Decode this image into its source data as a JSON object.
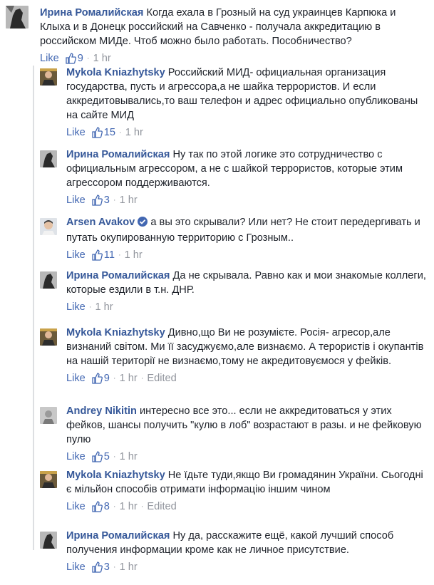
{
  "top": {
    "author": "Ирина Ромалийская",
    "text": "Когда ехала в Грозный на суд украинцев Карпюка и Клыха и в Донецк российский на Савченко - получала аккредитацию в российском МИДе. Чтоб можно было работать. Пособничество?",
    "like_label": "Like",
    "reactions": "9",
    "time": "1 hr"
  },
  "replies": [
    {
      "author": "Mykola Kniazhytsky",
      "text": "Российский МИД- официальная организация государства, пусть и агрессора,а не шайка террористов. И если аккредитовывались,то ваш телефон и адрес официально опубликованы на сайте МИД",
      "like_label": "Like",
      "reactions": "15",
      "time": "1 hr",
      "edited": ""
    },
    {
      "author": "Ирина Ромалийская",
      "text": "Ну так по этой логике это сотрудничество с официальным агрессором, а не с шайкой террористов, которые этим агрессором поддерживаются.",
      "like_label": "Like",
      "reactions": "3",
      "time": "1 hr",
      "edited": ""
    },
    {
      "author": "Arsen Avakov",
      "text": "а вы это скрывали? Или нет? Не стоит передергивать и путать окупированную территорию с Грозным..",
      "like_label": "Like",
      "reactions": "11",
      "time": "1 hr",
      "edited": "",
      "verified": true
    },
    {
      "author": "Ирина Ромалийская",
      "text": "Да не скрывала. Равно как и мои знакомые коллеги, которые ездили в т.н. ДНР.",
      "like_label": "Like",
      "reactions": "",
      "time": "1 hr",
      "edited": ""
    },
    {
      "author": "Mykola Kniazhytsky",
      "text": "Дивно,що Ви не розумієте. Росія- агресор,але визнаний світом. Ми її засуджуємо,але визнаємо. А терористів і окупантів на нашій території не визнаємо,тому не акредитовуємося у фейків.",
      "like_label": "Like",
      "reactions": "9",
      "time": "1 hr",
      "edited": "Edited"
    },
    {
      "author": "Andrey Nikitin",
      "text": "интересно все это... если не аккредитоваться у этих фейков, шансы получить \"кулю в лоб\" возрастают в разы. и не фейковую пулю",
      "like_label": "Like",
      "reactions": "5",
      "time": "1 hr",
      "edited": ""
    },
    {
      "author": "Mykola Kniazhytsky",
      "text": "Не їдьте туди,якщо Ви громадянин України. Сьогодні є мільйон способів отримати інформацію іншим чином",
      "like_label": "Like",
      "reactions": "8",
      "time": "1 hr",
      "edited": "Edited"
    },
    {
      "author": "Ирина Ромалийская",
      "text": "Ну да, расскажите ещё, какой лучший способ получения информации кроме как не личное присутствие.",
      "like_label": "Like",
      "reactions": "3",
      "time": "1 hr",
      "edited": ""
    }
  ],
  "colors": {
    "link": "#365899",
    "like": "#4267b2",
    "meta": "#90949c",
    "verified": "#4267b2"
  },
  "icons": {
    "reaction": "thumbs-up-icon",
    "verified": "verified-badge-icon"
  }
}
